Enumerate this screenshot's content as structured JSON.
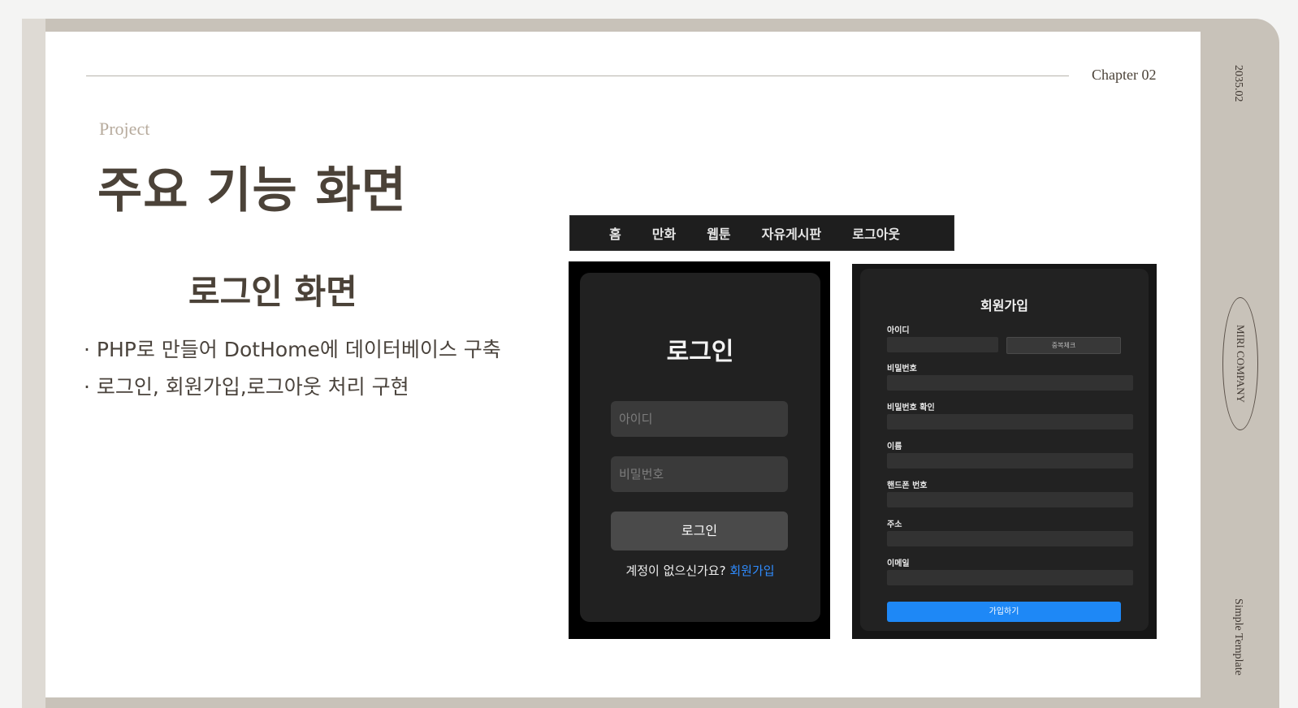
{
  "header": {
    "chapter": "Chapter 02"
  },
  "side": {
    "date": "2035.02",
    "company": "MIRI COMPANY",
    "template": "Simple Template"
  },
  "slide": {
    "eyebrow": "Project",
    "title": "주요 기능 화면",
    "subtitle": "로그인 화면",
    "bullets": [
      "· PHP로 만들어 DotHome에 데이터베이스 구축",
      "· 로그인, 회원가입,로그아웃 처리 구현"
    ]
  },
  "nav": {
    "items": [
      "홈",
      "만화",
      "웹툰",
      "자유게시판",
      "로그아웃"
    ]
  },
  "login": {
    "title": "로그인",
    "id_placeholder": "아이디",
    "pw_placeholder": "비밀번호",
    "button": "로그인",
    "footer_text": "계정이 없으신가요?",
    "footer_link": "회원가입"
  },
  "signup": {
    "title": "회원가입",
    "labels": [
      "아이디",
      "비밀번호",
      "비밀번호 확인",
      "이름",
      "핸드폰 번호",
      "주소",
      "이메일"
    ],
    "check_button": "중복체크",
    "submit": "가입하기"
  },
  "colors": {
    "accent_link": "#2f8cff",
    "submit_button": "#1e88f6",
    "title_text": "#4b4238"
  }
}
